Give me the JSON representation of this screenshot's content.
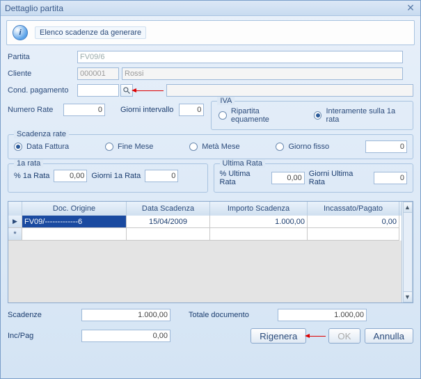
{
  "window": {
    "title": "Dettaglio partita"
  },
  "info": {
    "text": "Elenco scadenze da generare"
  },
  "fields": {
    "partita_label": "Partita",
    "partita_value": "FV09/6",
    "cliente_label": "Cliente",
    "cliente_code": "000001",
    "cliente_name": "Rossi",
    "condpag_label": "Cond. pagamento",
    "condpag_value": "",
    "numero_rate_label": "Numero Rate",
    "numero_rate_value": "0",
    "giorni_intervallo_label": "Giorni intervallo",
    "giorni_intervallo_value": "0"
  },
  "iva": {
    "title": "IVA",
    "opt1": "Ripartita equamente",
    "opt2": "Interamente sulla 1a rata",
    "selected": "opt2"
  },
  "scadenza_rate": {
    "title": "Scadenza rate",
    "opt1": "Data Fattura",
    "opt2": "Fine Mese",
    "opt3": "Metà Mese",
    "opt4": "Giorno fisso",
    "giorno_fisso_value": "0",
    "selected": "opt1"
  },
  "rata1": {
    "title": "1a rata",
    "pct_label": "% 1a  Rata",
    "pct_value": "0,00",
    "giorni_label": "Giorni 1a Rata",
    "giorni_value": "0"
  },
  "rataU": {
    "title": "Ultima Rata",
    "pct_label": "% Ultima Rata",
    "pct_value": "0,00",
    "giorni_label": "Giorni Ultima Rata",
    "giorni_value": "0"
  },
  "grid": {
    "headers": {
      "doc": "Doc. Origine",
      "data": "Data Scadenza",
      "importo": "Importo Scadenza",
      "incassato": "Incassato/Pagato"
    },
    "rows": [
      {
        "marker": "▶",
        "doc": "FV09/-------------6",
        "data": "15/04/2009",
        "importo": "1.000,00",
        "incassato": "0,00"
      },
      {
        "marker": "*",
        "doc": "",
        "data": "",
        "importo": "",
        "incassato": ""
      }
    ]
  },
  "totals": {
    "scadenze_label": "Scadenze",
    "scadenze_value": "1.000,00",
    "totdoc_label": "Totale documento",
    "totdoc_value": "1.000,00",
    "incpag_label": "Inc/Pag",
    "incpag_value": "0,00"
  },
  "buttons": {
    "rigenera": "Rigenera",
    "ok": "OK",
    "annulla": "Annulla"
  }
}
